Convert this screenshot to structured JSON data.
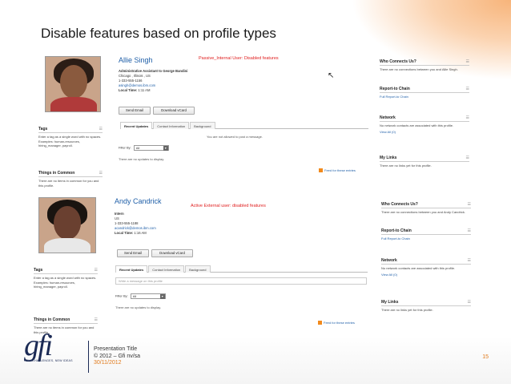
{
  "slide": {
    "title": "Disable features based on profile types"
  },
  "profiles": [
    {
      "name": "Allie Singh",
      "note": "Passive_Internal User: Disabled features",
      "job": "Administrative Assistant to George Bandini",
      "location": "Chicago , Illinois , US",
      "phone": "1-333-555-1156",
      "email": "asingh@demos.ibm.com",
      "local_time_label": "Local Time:",
      "local_time": "1:11 AM",
      "send_email": "Send Email",
      "download_vcard": "Download vCard",
      "tabs": [
        "Recent Updates",
        "Contact Information",
        "Background"
      ],
      "post_notice": "You are not allowed to post a message.",
      "filter_label": "Filter By:",
      "filter_value": "All",
      "no_updates": "There are no updates to display.",
      "feed": "Feed for these entries",
      "tags_title": "Tags",
      "tags_help": "Enter a tag as a single word with no spaces. Examples: human-resources, hiring_manager, payroll.",
      "common_title": "Things in Common",
      "common_text": "There are no items in common for you and this profile.",
      "side": {
        "connects_title": "Who Connects Us?",
        "connects_text": "There are no connections between you and Allie Singh.",
        "report_title": "Report-to Chain",
        "report_link": "Full Report-to Chain",
        "network_title": "Network",
        "network_text": "No network contacts are associated with this profile.",
        "network_link": "View All (0)",
        "links_title": "My Links",
        "links_text": "There are no links yet for this profile."
      }
    },
    {
      "name": "Andy Candrick",
      "note": "Active External user: disabled features",
      "job": "Intern",
      "location": "US",
      "phone": "1-333-555-1188",
      "email": "acandrick@demos.ibm.com",
      "local_time_label": "Local Time:",
      "local_time": "1:16 AM",
      "send_email": "Send Email",
      "download_vcard": "Download vCard",
      "tabs": [
        "Recent Updates",
        "Contact Information",
        "Background"
      ],
      "post_placeholder": "Write a message on this profile",
      "filter_label": "Filter By:",
      "filter_value": "All",
      "no_updates": "There are no updates to display.",
      "feed": "Feed for these entries",
      "tags_title": "Tags",
      "tags_help": "Enter a tag as a single word with no spaces. Examples: human-resources, hiring_manager, payroll.",
      "common_title": "Things in Common",
      "common_text": "There are no items in common for you and this profile.",
      "side": {
        "connects_title": "Who Connects Us?",
        "connects_text": "There are no connections between you and Andy Candrick.",
        "report_title": "Report-to Chain",
        "report_link": "Full Report-to Chain",
        "network_title": "Network",
        "network_text": "No network contacts are associated with this profile.",
        "network_link": "View All (0)",
        "links_title": "My Links",
        "links_text": "There are no links yet for this profile."
      }
    }
  ],
  "footer": {
    "logo": "gfi",
    "logo_tagline": "NEW CHALLENGES, NEW IDEAS",
    "line1": "Presentation Title",
    "line2": "© 2012 – Gfi nv/sa",
    "date": "30/11/2012",
    "page": "15"
  },
  "colors": {
    "accent": "#e07a1c",
    "link": "#1f5fa8",
    "warning": "#e02020",
    "brand": "#1b2a55"
  }
}
